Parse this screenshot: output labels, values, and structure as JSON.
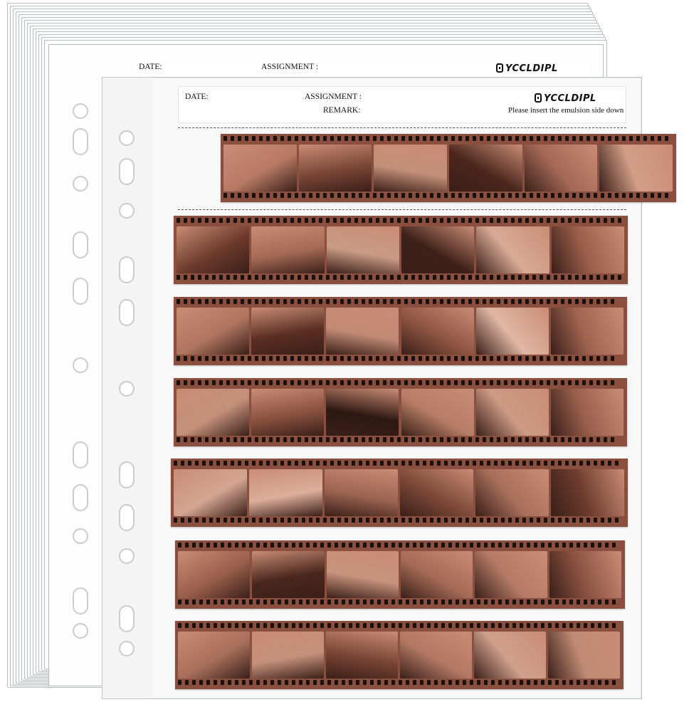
{
  "back_sheet": {
    "date_label": "DATE:",
    "assignment_label": "ASSIGNMENT :",
    "brand": "YCCLDIPL"
  },
  "front_sheet": {
    "date_label": "DATE:",
    "assignment_label": "ASSIGNMENT :",
    "remark_label": "REMARK:",
    "brand": "YCCLDIPL",
    "instruction": "Please insert the emulsion side down"
  },
  "colors": {
    "film_base": "#8a4f3e",
    "frame_light": "#c98c76",
    "frame_dark": "#3a1f18",
    "perforation": "#1b0f0b",
    "sleeve": "#f9f9fa"
  },
  "film_strips": [
    {
      "row": 1,
      "frames": 6
    },
    {
      "row": 2,
      "frames": 6
    },
    {
      "row": 3,
      "frames": 6
    },
    {
      "row": 4,
      "frames": 6
    },
    {
      "row": 5,
      "frames": 6
    },
    {
      "row": 6,
      "frames": 6
    },
    {
      "row": 7,
      "frames": 6
    }
  ]
}
